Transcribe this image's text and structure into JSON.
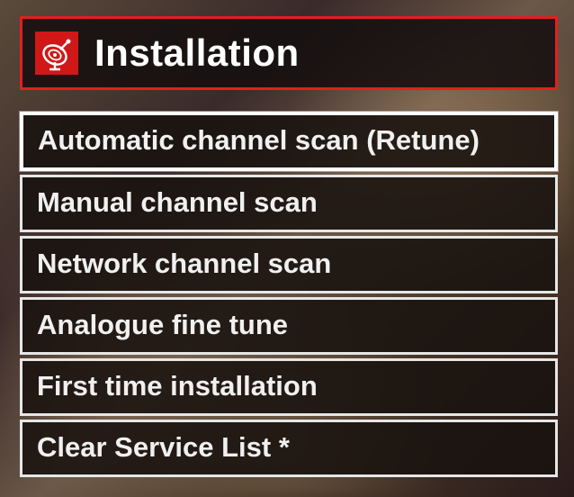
{
  "header": {
    "icon": "satellite-dish-icon",
    "title": "Installation"
  },
  "menu": {
    "items": [
      {
        "label": "Automatic channel scan (Retune)",
        "selected": true
      },
      {
        "label": "Manual channel scan",
        "selected": false
      },
      {
        "label": "Network channel scan",
        "selected": false
      },
      {
        "label": "Analogue fine tune",
        "selected": false
      },
      {
        "label": "First time installation",
        "selected": false
      },
      {
        "label": "Clear Service List *",
        "selected": false
      }
    ]
  }
}
